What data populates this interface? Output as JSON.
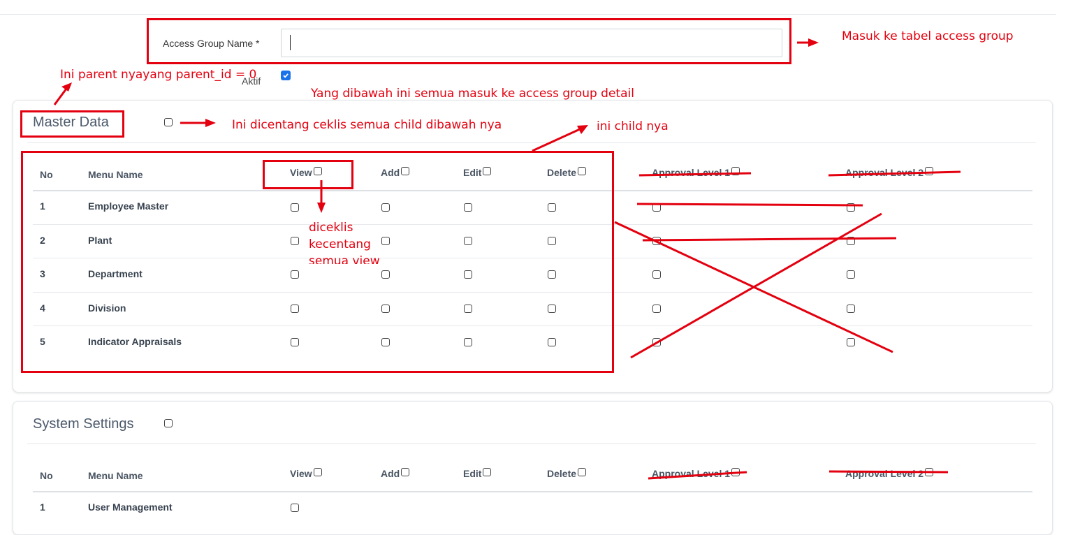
{
  "form": {
    "name_label": "Access Group Name *",
    "name_value": "",
    "aktif_label": "Aktif",
    "aktif_checked": true
  },
  "columns": [
    "No",
    "Menu Name",
    "View",
    "Add",
    "Edit",
    "Delete",
    "Approval Level 1",
    "Approval Level 2"
  ],
  "sections": [
    {
      "title": "Master Data",
      "rows": [
        {
          "no": "1",
          "name": "Employee Master"
        },
        {
          "no": "2",
          "name": "Plant"
        },
        {
          "no": "3",
          "name": "Department"
        },
        {
          "no": "4",
          "name": "Division"
        },
        {
          "no": "5",
          "name": "Indicator Appraisals"
        }
      ]
    },
    {
      "title": "System Settings",
      "rows": [
        {
          "no": "1",
          "name": "User Management"
        }
      ]
    }
  ],
  "annotations": {
    "masuk_tabel": "Masuk ke tabel access group",
    "parent": "Ini parent nyayang parent_id = 0",
    "detail": "Yang dibawah ini semua masuk ke access group detail",
    "dicentang": "Ini dicentang ceklis semua child dibawah nya",
    "child": "ini child nya",
    "diceklis_1": "diceklis",
    "diceklis_2": "kecentang",
    "diceklis_3": "semua view"
  },
  "colors": {
    "annotation": "#e3000f",
    "accent": "#1a73e8"
  }
}
